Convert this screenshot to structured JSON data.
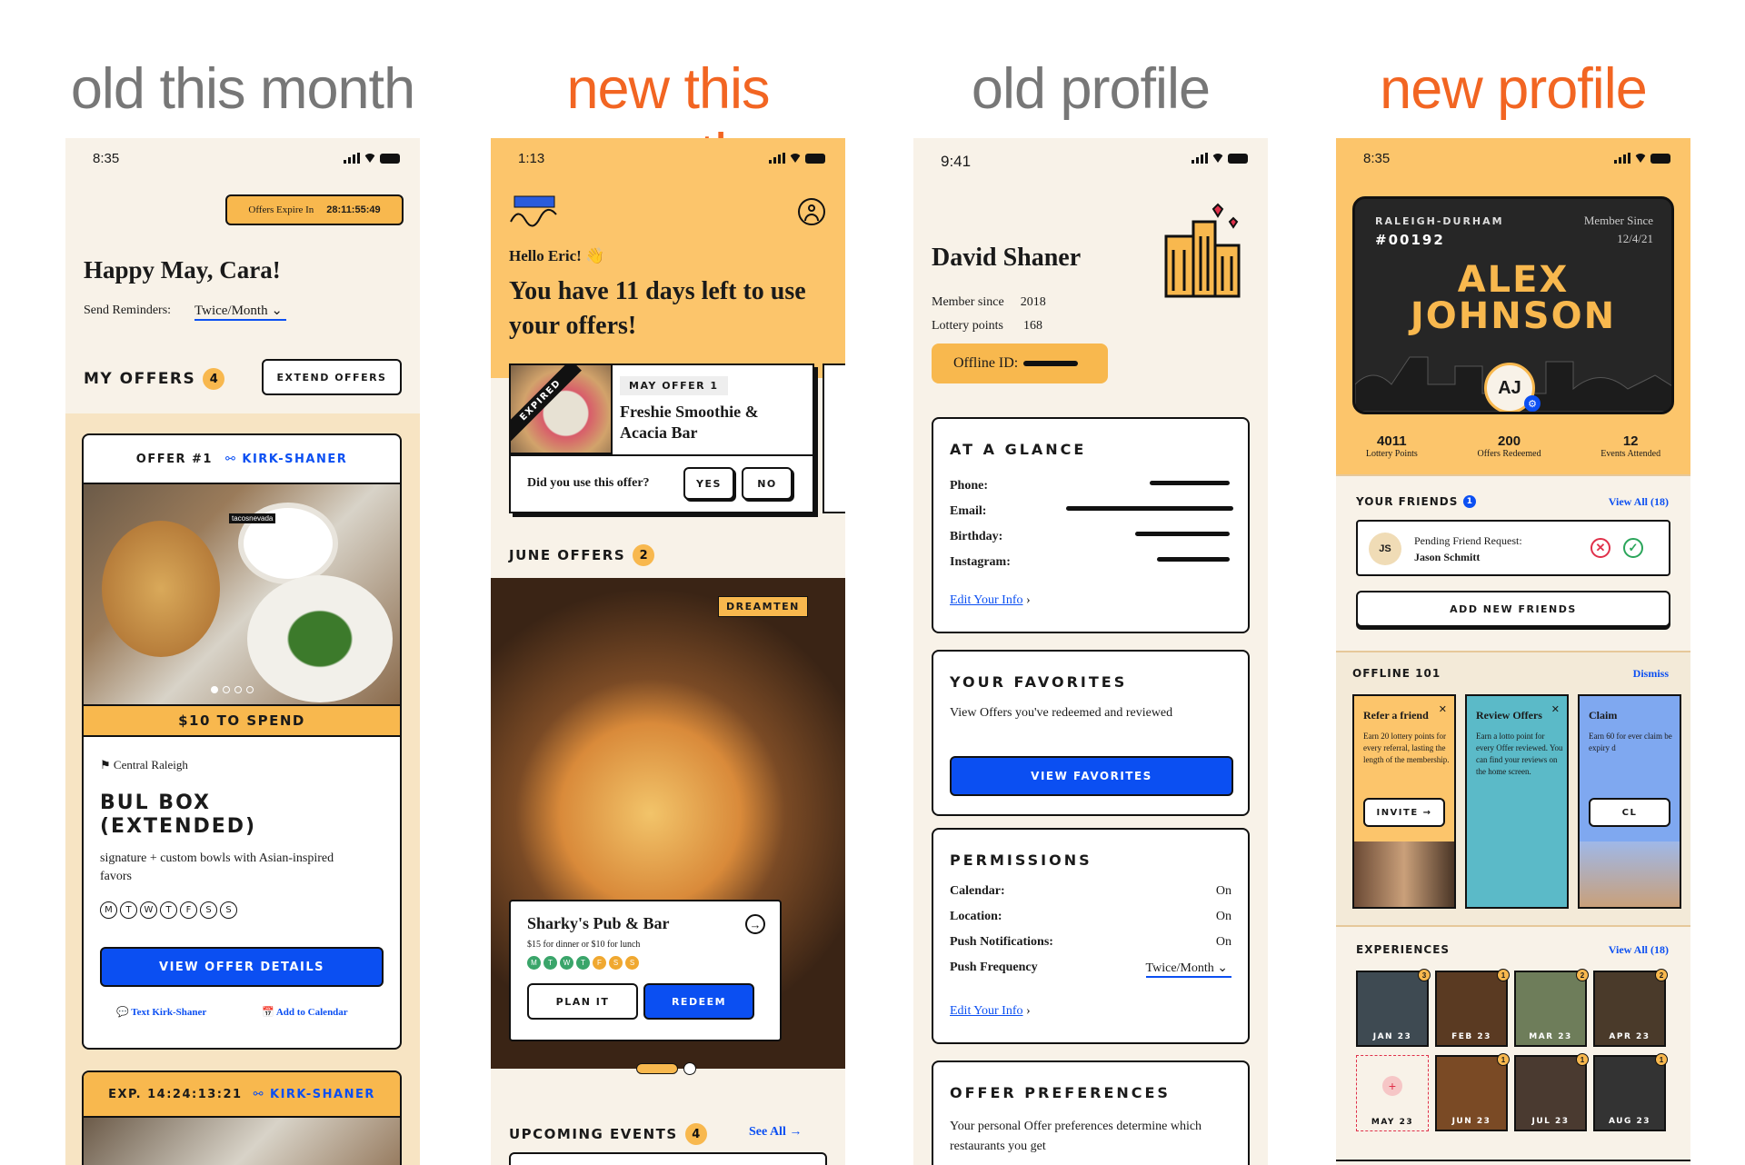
{
  "headings": {
    "h1": "old this month",
    "h2": "new this month",
    "h3": "old profile",
    "h4": "new profile"
  },
  "colors": {
    "accent_orange": "#f8b84e",
    "heading_orange": "#f26522",
    "blue": "#0b4ff2",
    "cream": "#f8f2e8"
  },
  "phone1": {
    "time": "8:35",
    "expire_label": "Offers Expire In",
    "expire_value": "28:11:55:49",
    "greeting": "Happy May, Cara!",
    "reminders_label": "Send Reminders:",
    "reminders_value": "Twice/Month",
    "my_offers": "MY OFFERS",
    "my_offers_count": "4",
    "extend_btn": "EXTEND OFFERS",
    "offer_title": "OFFER #1",
    "offer_link": "KIRK-SHANER",
    "to_spend": "$10 TO SPEND",
    "location": "Central Raleigh",
    "restaurant": "BUL BOX (EXTENDED)",
    "description": "signature + custom bowls with Asian-inspired favors",
    "days": [
      "M",
      "T",
      "W",
      "T",
      "F",
      "S",
      "S"
    ],
    "view_btn": "VIEW OFFER DETAILS",
    "text_link": "Text Kirk-Shaner",
    "calendar_link": "Add to Calendar",
    "exp_label": "EXP. 14:24:13:21",
    "exp_link": "KIRK-SHANER",
    "image_tag": "tacosnevada"
  },
  "phone2": {
    "time": "1:13",
    "greeting": "Hello Eric! 👋",
    "headline": "You have 11 days left to use your offers!",
    "expired": "EXPIRED",
    "may_tag": "MAY OFFER 1",
    "may_name": "Freshie Smoothie & Acacia Bar",
    "question": "Did you use this offer?",
    "yes": "YES",
    "no": "NO",
    "june_offers": "JUNE OFFERS",
    "june_count": "2",
    "tag": "DREAMTEN",
    "pub_name": "Sharky's Pub & Bar",
    "pub_desc": "$15 for dinner or $10 for lunch",
    "plan": "PLAN IT",
    "redeem": "REDEEM",
    "upcoming": "UPCOMING EVENTS",
    "upcoming_count": "4",
    "see_all": "See All"
  },
  "phone3": {
    "time": "9:41",
    "name": "David Shaner",
    "member_label": "Member since",
    "member_value": "2018",
    "lottery_label": "Lottery points",
    "lottery_value": "168",
    "offline_id": "Offline ID:",
    "glance": "AT A GLANCE",
    "glance_fields": [
      "Phone:",
      "Email:",
      "Birthday:",
      "Instagram:"
    ],
    "edit": "Edit Your Info",
    "favorites": "YOUR FAVORITES",
    "favorites_desc": "View Offers you've redeemed and reviewed",
    "view_fav": "VIEW FAVORITES",
    "permissions": "PERMISSIONS",
    "perm_rows": [
      {
        "label": "Calendar:",
        "value": "On"
      },
      {
        "label": "Location:",
        "value": "On"
      },
      {
        "label": "Push Notifications:",
        "value": "On"
      },
      {
        "label": "Push Frequency",
        "value": "Twice/Month"
      }
    ],
    "edit2": "Edit Your Info",
    "prefs": "OFFER PREFERENCES",
    "prefs_desc": "Your personal Offer preferences determine which restaurants you get"
  },
  "phone4": {
    "time": "8:35",
    "city": "RALEIGH-DURHAM",
    "number": "#00192",
    "since_label": "Member Since",
    "since_value": "12/4/21",
    "first": "ALEX",
    "last": "JOHNSON",
    "initials": "AJ",
    "stats": [
      {
        "value": "4011",
        "label": "Lottery Points"
      },
      {
        "value": "200",
        "label": "Offers Redeemed"
      },
      {
        "value": "12",
        "label": "Events Attended"
      }
    ],
    "friends": "YOUR FRIENDS",
    "friends_count": "1",
    "view_all": "View All (18)",
    "pending": "Pending Friend Request:",
    "pending_name": "Jason Schmitt",
    "pending_initials": "JS",
    "add_friends": "ADD NEW FRIENDS",
    "offline101": "OFFLINE 101",
    "dismiss": "Dismiss",
    "cards": [
      {
        "title": "Refer a friend",
        "desc": "Earn 20 lottery points for every referral, lasting the length of the membership.",
        "btn": "INVITE →"
      },
      {
        "title": "Review Offers",
        "desc": "Earn a lotto point for every Offer reviewed. You can find your reviews on the home screen.",
        "btn": ""
      },
      {
        "title": "Claim",
        "desc": "Earn 60 for ever claim be expiry d",
        "btn": "CL"
      }
    ],
    "experiences": "EXPERIENCES",
    "exp_view_all": "View All (18)",
    "months": [
      {
        "m": "JAN 23",
        "n": "3"
      },
      {
        "m": "FEB 23",
        "n": "1"
      },
      {
        "m": "MAR 23",
        "n": "2"
      },
      {
        "m": "APR 23",
        "n": "2"
      },
      {
        "m": "MAY 23",
        "n": ""
      },
      {
        "m": "JUN 23",
        "n": "1"
      },
      {
        "m": "JUL 23",
        "n": "1"
      },
      {
        "m": "AUG 23",
        "n": "1"
      }
    ]
  }
}
